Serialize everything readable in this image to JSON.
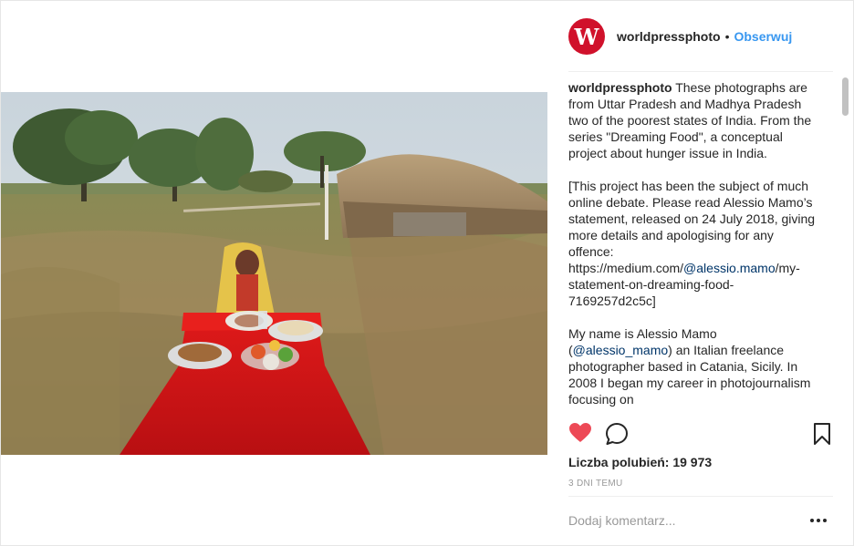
{
  "header": {
    "avatar_letter": "W",
    "username": "worldpressphoto",
    "separator": "•",
    "follow_label": "Obserwuj"
  },
  "caption": {
    "username": "worldpressphoto",
    "p1": " These photographs are from Uttar Pradesh and Madhya Pradesh two of the poorest states of India. From the series \"Dreaming Food\", a conceptual project about hunger issue in India.",
    "p2_before": "[This project has been the subject of much online debate. Please read Alessio Mamo’s statement, released on 24 July 2018, giving more details and apologising for any offence: https://medium.com/",
    "p2_link": "@alessio.mamo",
    "p2_after": "/my-statement-on-dreaming-food-7169257d2c5c]",
    "p3_before": "My name is Alessio Mamo (",
    "p3_link": "@alessio_mamo",
    "p3_after": ") an Italian freelance photographer based in Catania, Sicily. In 2008 I began my career in photojournalism focusing on"
  },
  "likes_text": "Liczba polubień: 19 973",
  "time_text": "3 DNI TEMU",
  "comment_placeholder": "Dodaj komentarz...",
  "colors": {
    "avatar_bg": "#d0112b",
    "follow": "#3897f0",
    "heart": "#ed4956",
    "link": "#003569",
    "muted": "#999999"
  },
  "icons": [
    "heart-icon",
    "comment-icon",
    "bookmark-icon",
    "more-options-icon"
  ]
}
